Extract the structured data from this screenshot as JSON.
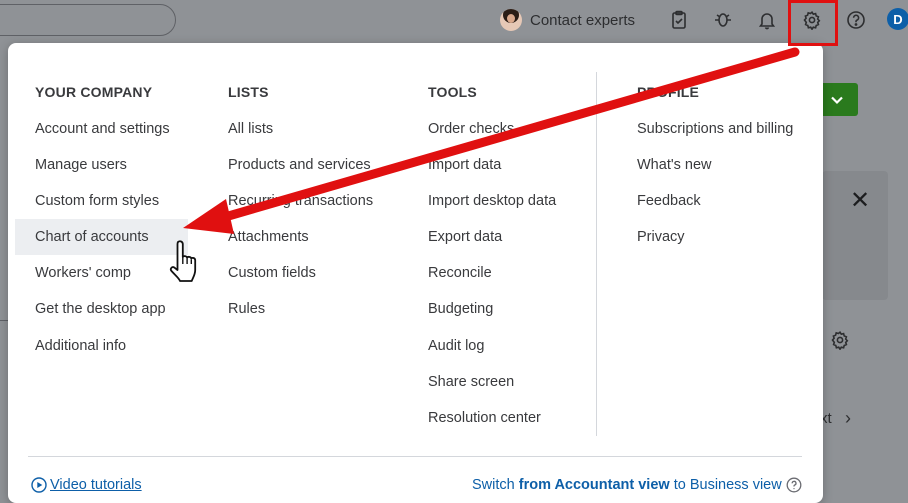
{
  "topbar": {
    "contact_experts": "Contact experts",
    "user_initial": "D",
    "icons": [
      "clipboard-icon",
      "bug-icon",
      "bell-icon",
      "gear-icon",
      "help-icon"
    ]
  },
  "menu": {
    "your_company": {
      "heading": "YOUR COMPANY",
      "items": [
        "Account and settings",
        "Manage users",
        "Custom form styles",
        "Chart of accounts",
        "Workers' comp",
        "Get the desktop app",
        "Additional info"
      ]
    },
    "lists": {
      "heading": "LISTS",
      "items": [
        "All lists",
        "Products and services",
        "Recurring transactions",
        "Attachments",
        "Custom fields",
        "Rules"
      ]
    },
    "tools": {
      "heading": "TOOLS",
      "items": [
        "Order checks",
        "Import data",
        "Import desktop data",
        "Export data",
        "Reconcile",
        "Budgeting",
        "Audit log",
        "Share screen",
        "Resolution center"
      ]
    },
    "profile": {
      "heading": "PROFILE",
      "items": [
        "Subscriptions and billing",
        "What's new",
        "Feedback",
        "Privacy"
      ]
    },
    "footer": {
      "video_tutorials": "Video tutorials",
      "switch_prefix": "Switch ",
      "switch_bold": "from Accountant view",
      "switch_suffix": " to Business view"
    }
  },
  "background": {
    "next_label": "xt"
  },
  "colors": {
    "annotation_red": "#e01010",
    "link_blue": "#0d5fa8",
    "primary_green": "#2a7a1d"
  }
}
